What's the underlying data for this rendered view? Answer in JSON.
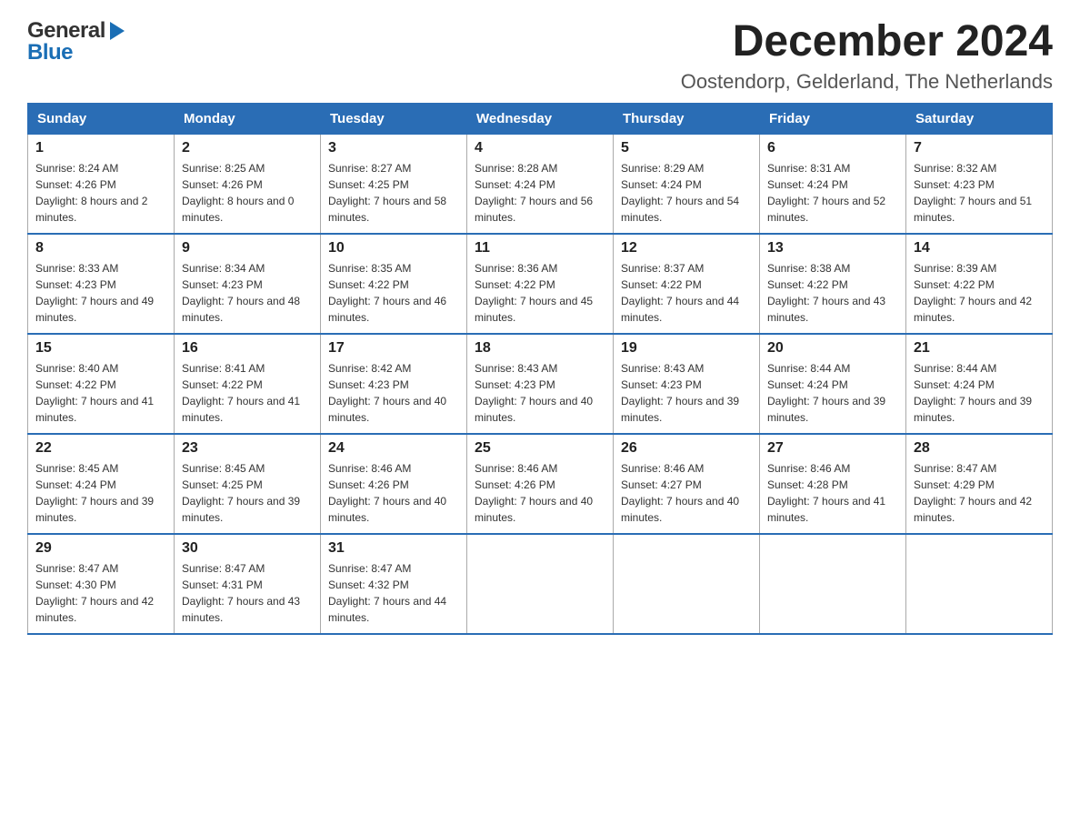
{
  "header": {
    "logo_general": "General",
    "logo_blue": "Blue",
    "title": "December 2024",
    "subtitle": "Oostendorp, Gelderland, The Netherlands"
  },
  "calendar": {
    "days_of_week": [
      "Sunday",
      "Monday",
      "Tuesday",
      "Wednesday",
      "Thursday",
      "Friday",
      "Saturday"
    ],
    "weeks": [
      [
        {
          "day": "1",
          "sunrise": "8:24 AM",
          "sunset": "4:26 PM",
          "daylight": "8 hours and 2 minutes."
        },
        {
          "day": "2",
          "sunrise": "8:25 AM",
          "sunset": "4:26 PM",
          "daylight": "8 hours and 0 minutes."
        },
        {
          "day": "3",
          "sunrise": "8:27 AM",
          "sunset": "4:25 PM",
          "daylight": "7 hours and 58 minutes."
        },
        {
          "day": "4",
          "sunrise": "8:28 AM",
          "sunset": "4:24 PM",
          "daylight": "7 hours and 56 minutes."
        },
        {
          "day": "5",
          "sunrise": "8:29 AM",
          "sunset": "4:24 PM",
          "daylight": "7 hours and 54 minutes."
        },
        {
          "day": "6",
          "sunrise": "8:31 AM",
          "sunset": "4:24 PM",
          "daylight": "7 hours and 52 minutes."
        },
        {
          "day": "7",
          "sunrise": "8:32 AM",
          "sunset": "4:23 PM",
          "daylight": "7 hours and 51 minutes."
        }
      ],
      [
        {
          "day": "8",
          "sunrise": "8:33 AM",
          "sunset": "4:23 PM",
          "daylight": "7 hours and 49 minutes."
        },
        {
          "day": "9",
          "sunrise": "8:34 AM",
          "sunset": "4:23 PM",
          "daylight": "7 hours and 48 minutes."
        },
        {
          "day": "10",
          "sunrise": "8:35 AM",
          "sunset": "4:22 PM",
          "daylight": "7 hours and 46 minutes."
        },
        {
          "day": "11",
          "sunrise": "8:36 AM",
          "sunset": "4:22 PM",
          "daylight": "7 hours and 45 minutes."
        },
        {
          "day": "12",
          "sunrise": "8:37 AM",
          "sunset": "4:22 PM",
          "daylight": "7 hours and 44 minutes."
        },
        {
          "day": "13",
          "sunrise": "8:38 AM",
          "sunset": "4:22 PM",
          "daylight": "7 hours and 43 minutes."
        },
        {
          "day": "14",
          "sunrise": "8:39 AM",
          "sunset": "4:22 PM",
          "daylight": "7 hours and 42 minutes."
        }
      ],
      [
        {
          "day": "15",
          "sunrise": "8:40 AM",
          "sunset": "4:22 PM",
          "daylight": "7 hours and 41 minutes."
        },
        {
          "day": "16",
          "sunrise": "8:41 AM",
          "sunset": "4:22 PM",
          "daylight": "7 hours and 41 minutes."
        },
        {
          "day": "17",
          "sunrise": "8:42 AM",
          "sunset": "4:23 PM",
          "daylight": "7 hours and 40 minutes."
        },
        {
          "day": "18",
          "sunrise": "8:43 AM",
          "sunset": "4:23 PM",
          "daylight": "7 hours and 40 minutes."
        },
        {
          "day": "19",
          "sunrise": "8:43 AM",
          "sunset": "4:23 PM",
          "daylight": "7 hours and 39 minutes."
        },
        {
          "day": "20",
          "sunrise": "8:44 AM",
          "sunset": "4:24 PM",
          "daylight": "7 hours and 39 minutes."
        },
        {
          "day": "21",
          "sunrise": "8:44 AM",
          "sunset": "4:24 PM",
          "daylight": "7 hours and 39 minutes."
        }
      ],
      [
        {
          "day": "22",
          "sunrise": "8:45 AM",
          "sunset": "4:24 PM",
          "daylight": "7 hours and 39 minutes."
        },
        {
          "day": "23",
          "sunrise": "8:45 AM",
          "sunset": "4:25 PM",
          "daylight": "7 hours and 39 minutes."
        },
        {
          "day": "24",
          "sunrise": "8:46 AM",
          "sunset": "4:26 PM",
          "daylight": "7 hours and 40 minutes."
        },
        {
          "day": "25",
          "sunrise": "8:46 AM",
          "sunset": "4:26 PM",
          "daylight": "7 hours and 40 minutes."
        },
        {
          "day": "26",
          "sunrise": "8:46 AM",
          "sunset": "4:27 PM",
          "daylight": "7 hours and 40 minutes."
        },
        {
          "day": "27",
          "sunrise": "8:46 AM",
          "sunset": "4:28 PM",
          "daylight": "7 hours and 41 minutes."
        },
        {
          "day": "28",
          "sunrise": "8:47 AM",
          "sunset": "4:29 PM",
          "daylight": "7 hours and 42 minutes."
        }
      ],
      [
        {
          "day": "29",
          "sunrise": "8:47 AM",
          "sunset": "4:30 PM",
          "daylight": "7 hours and 42 minutes."
        },
        {
          "day": "30",
          "sunrise": "8:47 AM",
          "sunset": "4:31 PM",
          "daylight": "7 hours and 43 minutes."
        },
        {
          "day": "31",
          "sunrise": "8:47 AM",
          "sunset": "4:32 PM",
          "daylight": "7 hours and 44 minutes."
        },
        null,
        null,
        null,
        null
      ]
    ]
  }
}
